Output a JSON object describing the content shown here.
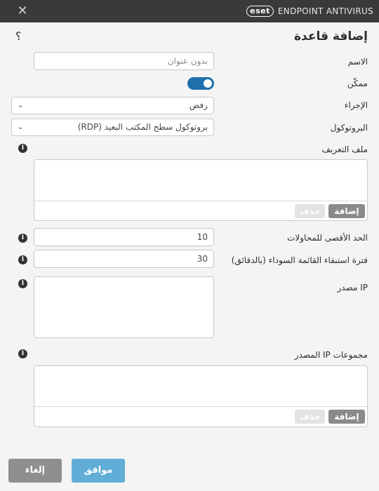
{
  "titlebar": {
    "brand_logo": "eset",
    "brand_name": "ENDPOINT ANTIVIRUS",
    "close_glyph": "✕"
  },
  "dialog": {
    "title": "إضافة قاعدة",
    "help_glyph": "؟"
  },
  "fields": {
    "name": {
      "label": "الاسم",
      "value": "",
      "placeholder": "بدون عنوان"
    },
    "enabled": {
      "label": "ممكّن",
      "on": true
    },
    "action": {
      "label": "الإجراء",
      "value": "رفض"
    },
    "protocol": {
      "label": "البروتوكول",
      "value": "بروتوكول سطح المكتب البعيد (RDP)"
    },
    "profile": {
      "label": "ملف التعريف",
      "add_label": "إضافة",
      "delete_label": "حذف"
    },
    "max_attempts": {
      "label": "الحد الأقصى للمحاولات",
      "value": "10"
    },
    "blacklist_retention": {
      "label": "فترة استبقاء القائمة السوداء (بالدقائق)",
      "value": "30"
    },
    "source_ip": {
      "label": "IP مصدر"
    },
    "source_ip_groups": {
      "label": "مجموعات IP المصدر",
      "add_label": "إضافة",
      "delete_label": "حذف"
    }
  },
  "icons": {
    "info": "info-icon",
    "chevron": "chevron-down-icon",
    "close": "close-icon",
    "help": "help-icon"
  },
  "buttons": {
    "ok": "موافق",
    "cancel": "إلغاء"
  },
  "colors": {
    "titlebar": "#3a3a3c",
    "toggle": "#1f70aa",
    "ok": "#60aed8",
    "cancel": "#8f8f8f",
    "add": "#8a8a8a"
  }
}
